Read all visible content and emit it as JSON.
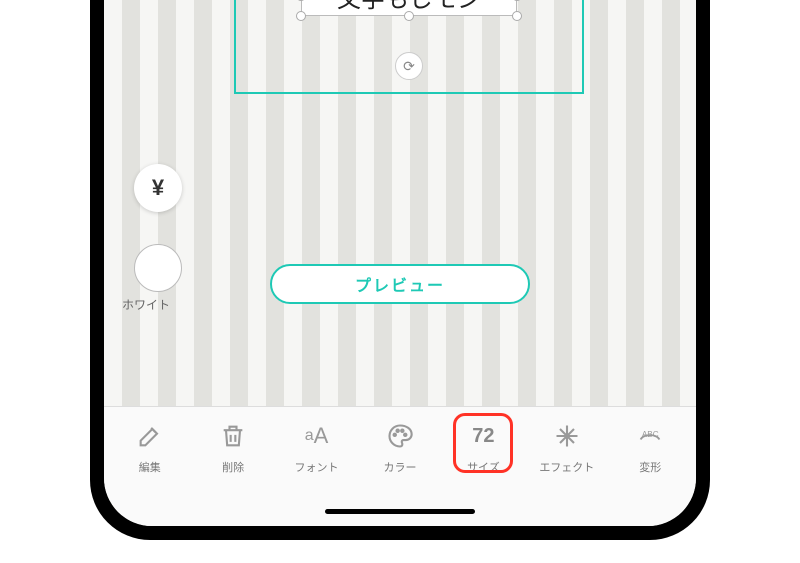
{
  "colors": {
    "accent": "#1ec9b5",
    "highlight": "#ff3226"
  },
  "canvas": {
    "text_value": "文字もじモジ"
  },
  "buttons": {
    "yen_symbol": "¥",
    "preview_label": "プレビュー"
  },
  "color_swatch": {
    "label": "ホワイト"
  },
  "toolbar": {
    "items": [
      {
        "id": "edit",
        "label": "編集",
        "icon": "edit"
      },
      {
        "id": "delete",
        "label": "削除",
        "icon": "trash"
      },
      {
        "id": "font",
        "label": "フォント",
        "icon": "aA"
      },
      {
        "id": "color",
        "label": "カラー",
        "icon": "palette"
      },
      {
        "id": "size",
        "label": "サイズ",
        "value": "72",
        "highlighted": true
      },
      {
        "id": "effect",
        "label": "エフェクト",
        "icon": "sparkle"
      },
      {
        "id": "transform",
        "label": "変形",
        "icon": "abc-arc"
      }
    ]
  }
}
